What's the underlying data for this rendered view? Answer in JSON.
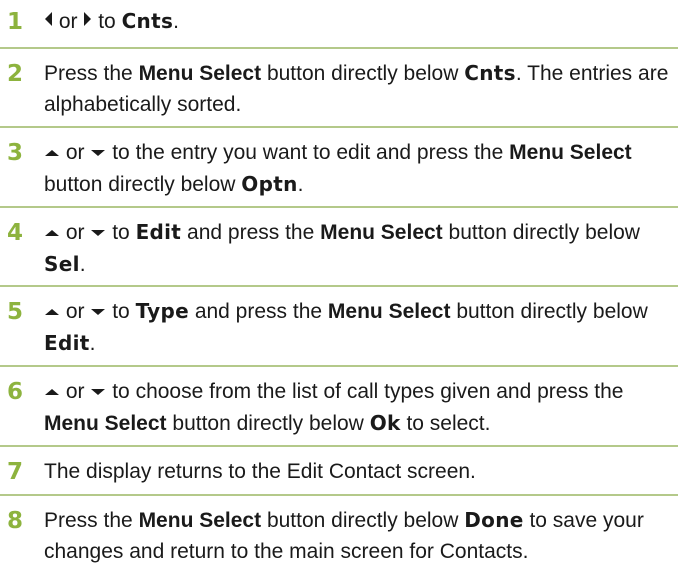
{
  "accent_color": "#8db33e",
  "rule_color": "#b4c98a",
  "icons": {
    "left": "left-arrow-icon",
    "right": "right-arrow-icon",
    "up": "up-arrow-icon",
    "down": "down-arrow-icon"
  },
  "steps": [
    {
      "number": "1",
      "or": "or",
      "to": "to",
      "screen_label": "Cnts",
      "end": "."
    },
    {
      "number": "2",
      "text_a": "Press the",
      "button": "Menu Select",
      "text_b": "button directly below",
      "screen_label": "Cnts",
      "text_c": ". The entries are alphabetically sorted."
    },
    {
      "number": "3",
      "or": "or",
      "text_a": "to the entry you want to edit and press the",
      "button": "Menu Select",
      "text_b": "button directly below",
      "screen_label": "Optn",
      "end": "."
    },
    {
      "number": "4",
      "or": "or",
      "to": "to",
      "label_1": "Edit",
      "text_a": "and press the",
      "button": "Menu Select",
      "text_b": "button directly below",
      "label_2": "Sel",
      "end": "."
    },
    {
      "number": "5",
      "or": "or",
      "to": "to",
      "label_1": "Type",
      "text_a": "and press the",
      "button": "Menu Select",
      "text_b": "button directly below",
      "label_2": "Edit",
      "end": "."
    },
    {
      "number": "6",
      "or": "or",
      "text_a": "to choose from the list of call types given and press the",
      "button": "Menu Select",
      "text_b": "button directly below",
      "screen_label": "Ok",
      "text_c": "to select."
    },
    {
      "number": "7",
      "text_a": "The display returns to the Edit Contact screen."
    },
    {
      "number": "8",
      "text_a": "Press the",
      "button": "Menu Select",
      "text_b": "button directly below",
      "screen_label": "Done",
      "text_c": "to save your changes and return to the main screen for Contacts."
    }
  ]
}
